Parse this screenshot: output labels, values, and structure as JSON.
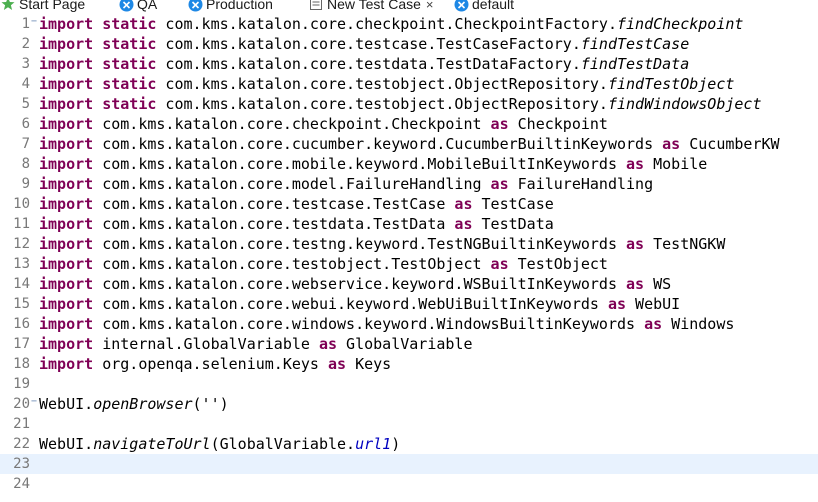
{
  "tabs": [
    {
      "label": "Start Page",
      "icon": "star-icon",
      "color": "#4caf50",
      "active": false
    },
    {
      "label": "QA",
      "icon": "profile-icon",
      "color": "#1e88e5",
      "active": false
    },
    {
      "label": "Production",
      "icon": "profile-icon",
      "color": "#1e88e5",
      "active": false
    },
    {
      "label": "New Test Case",
      "icon": "test-case-icon",
      "active": true,
      "close": "×"
    },
    {
      "label": "default",
      "icon": "profile-icon",
      "color": "#1e88e5",
      "active": false
    }
  ],
  "colors": {
    "keyword": "#7f0055",
    "field": "#0000c0",
    "line_number": "#787878",
    "current_line": "#e8f2fe"
  },
  "editor": {
    "current_line": 23,
    "lines": [
      {
        "n": "1",
        "fold": "−",
        "tokens": [
          {
            "t": "import",
            "c": "kw"
          },
          {
            "t": " "
          },
          {
            "t": "static",
            "c": "kw"
          },
          {
            "t": " com.kms.katalon.core.checkpoint.CheckpointFactory."
          },
          {
            "t": "findCheckpoint",
            "c": "it"
          }
        ]
      },
      {
        "n": "2",
        "tokens": [
          {
            "t": "import",
            "c": "kw"
          },
          {
            "t": " "
          },
          {
            "t": "static",
            "c": "kw"
          },
          {
            "t": " com.kms.katalon.core.testcase.TestCaseFactory."
          },
          {
            "t": "findTestCase",
            "c": "it"
          }
        ]
      },
      {
        "n": "3",
        "tokens": [
          {
            "t": "import",
            "c": "kw"
          },
          {
            "t": " "
          },
          {
            "t": "static",
            "c": "kw"
          },
          {
            "t": " com.kms.katalon.core.testdata.TestDataFactory."
          },
          {
            "t": "findTestData",
            "c": "it"
          }
        ]
      },
      {
        "n": "4",
        "tokens": [
          {
            "t": "import",
            "c": "kw"
          },
          {
            "t": " "
          },
          {
            "t": "static",
            "c": "kw"
          },
          {
            "t": " com.kms.katalon.core.testobject.ObjectRepository."
          },
          {
            "t": "findTestObject",
            "c": "it"
          }
        ]
      },
      {
        "n": "5",
        "tokens": [
          {
            "t": "import",
            "c": "kw"
          },
          {
            "t": " "
          },
          {
            "t": "static",
            "c": "kw"
          },
          {
            "t": " com.kms.katalon.core.testobject.ObjectRepository."
          },
          {
            "t": "findWindowsObject",
            "c": "it"
          }
        ]
      },
      {
        "n": "6",
        "tokens": [
          {
            "t": "import",
            "c": "kw"
          },
          {
            "t": " com.kms.katalon.core.checkpoint.Checkpoint "
          },
          {
            "t": "as",
            "c": "kw"
          },
          {
            "t": " Checkpoint"
          }
        ]
      },
      {
        "n": "7",
        "tokens": [
          {
            "t": "import",
            "c": "kw"
          },
          {
            "t": " com.kms.katalon.core.cucumber.keyword.CucumberBuiltinKeywords "
          },
          {
            "t": "as",
            "c": "kw"
          },
          {
            "t": " CucumberKW"
          }
        ]
      },
      {
        "n": "8",
        "tokens": [
          {
            "t": "import",
            "c": "kw"
          },
          {
            "t": " com.kms.katalon.core.mobile.keyword.MobileBuiltInKeywords "
          },
          {
            "t": "as",
            "c": "kw"
          },
          {
            "t": " Mobile"
          }
        ]
      },
      {
        "n": "9",
        "tokens": [
          {
            "t": "import",
            "c": "kw"
          },
          {
            "t": " com.kms.katalon.core.model.FailureHandling "
          },
          {
            "t": "as",
            "c": "kw"
          },
          {
            "t": " FailureHandling"
          }
        ]
      },
      {
        "n": "10",
        "tokens": [
          {
            "t": "import",
            "c": "kw"
          },
          {
            "t": " com.kms.katalon.core.testcase.TestCase "
          },
          {
            "t": "as",
            "c": "kw"
          },
          {
            "t": " TestCase"
          }
        ]
      },
      {
        "n": "11",
        "tokens": [
          {
            "t": "import",
            "c": "kw"
          },
          {
            "t": " com.kms.katalon.core.testdata.TestData "
          },
          {
            "t": "as",
            "c": "kw"
          },
          {
            "t": " TestData"
          }
        ]
      },
      {
        "n": "12",
        "tokens": [
          {
            "t": "import",
            "c": "kw"
          },
          {
            "t": " com.kms.katalon.core.testng.keyword.TestNGBuiltinKeywords "
          },
          {
            "t": "as",
            "c": "kw"
          },
          {
            "t": " TestNGKW"
          }
        ]
      },
      {
        "n": "13",
        "tokens": [
          {
            "t": "import",
            "c": "kw"
          },
          {
            "t": " com.kms.katalon.core.testobject.TestObject "
          },
          {
            "t": "as",
            "c": "kw"
          },
          {
            "t": " TestObject"
          }
        ]
      },
      {
        "n": "14",
        "tokens": [
          {
            "t": "import",
            "c": "kw"
          },
          {
            "t": " com.kms.katalon.core.webservice.keyword.WSBuiltInKeywords "
          },
          {
            "t": "as",
            "c": "kw"
          },
          {
            "t": " WS"
          }
        ]
      },
      {
        "n": "15",
        "tokens": [
          {
            "t": "import",
            "c": "kw"
          },
          {
            "t": " com.kms.katalon.core.webui.keyword.WebUiBuiltInKeywords "
          },
          {
            "t": "as",
            "c": "kw"
          },
          {
            "t": " WebUI"
          }
        ]
      },
      {
        "n": "16",
        "tokens": [
          {
            "t": "import",
            "c": "kw"
          },
          {
            "t": " com.kms.katalon.core.windows.keyword.WindowsBuiltinKeywords "
          },
          {
            "t": "as",
            "c": "kw"
          },
          {
            "t": " Windows"
          }
        ]
      },
      {
        "n": "17",
        "tokens": [
          {
            "t": "import",
            "c": "kw"
          },
          {
            "t": " internal.GlobalVariable "
          },
          {
            "t": "as",
            "c": "kw"
          },
          {
            "t": " GlobalVariable"
          }
        ]
      },
      {
        "n": "18",
        "tokens": [
          {
            "t": "import",
            "c": "kw"
          },
          {
            "t": " org.openqa.selenium.Keys "
          },
          {
            "t": "as",
            "c": "kw"
          },
          {
            "t": " Keys"
          }
        ]
      },
      {
        "n": "19",
        "tokens": []
      },
      {
        "n": "20",
        "fold": "−",
        "tokens": [
          {
            "t": "WebUI."
          },
          {
            "t": "openBrowser",
            "c": "it"
          },
          {
            "t": "('')"
          }
        ]
      },
      {
        "n": "21",
        "tokens": []
      },
      {
        "n": "22",
        "tokens": [
          {
            "t": "WebUI."
          },
          {
            "t": "navigateToUrl",
            "c": "it"
          },
          {
            "t": "(GlobalVariable."
          },
          {
            "t": "url1",
            "c": "fld"
          },
          {
            "t": ")"
          }
        ]
      },
      {
        "n": "23",
        "tokens": []
      },
      {
        "n": "24",
        "tokens": []
      }
    ]
  }
}
